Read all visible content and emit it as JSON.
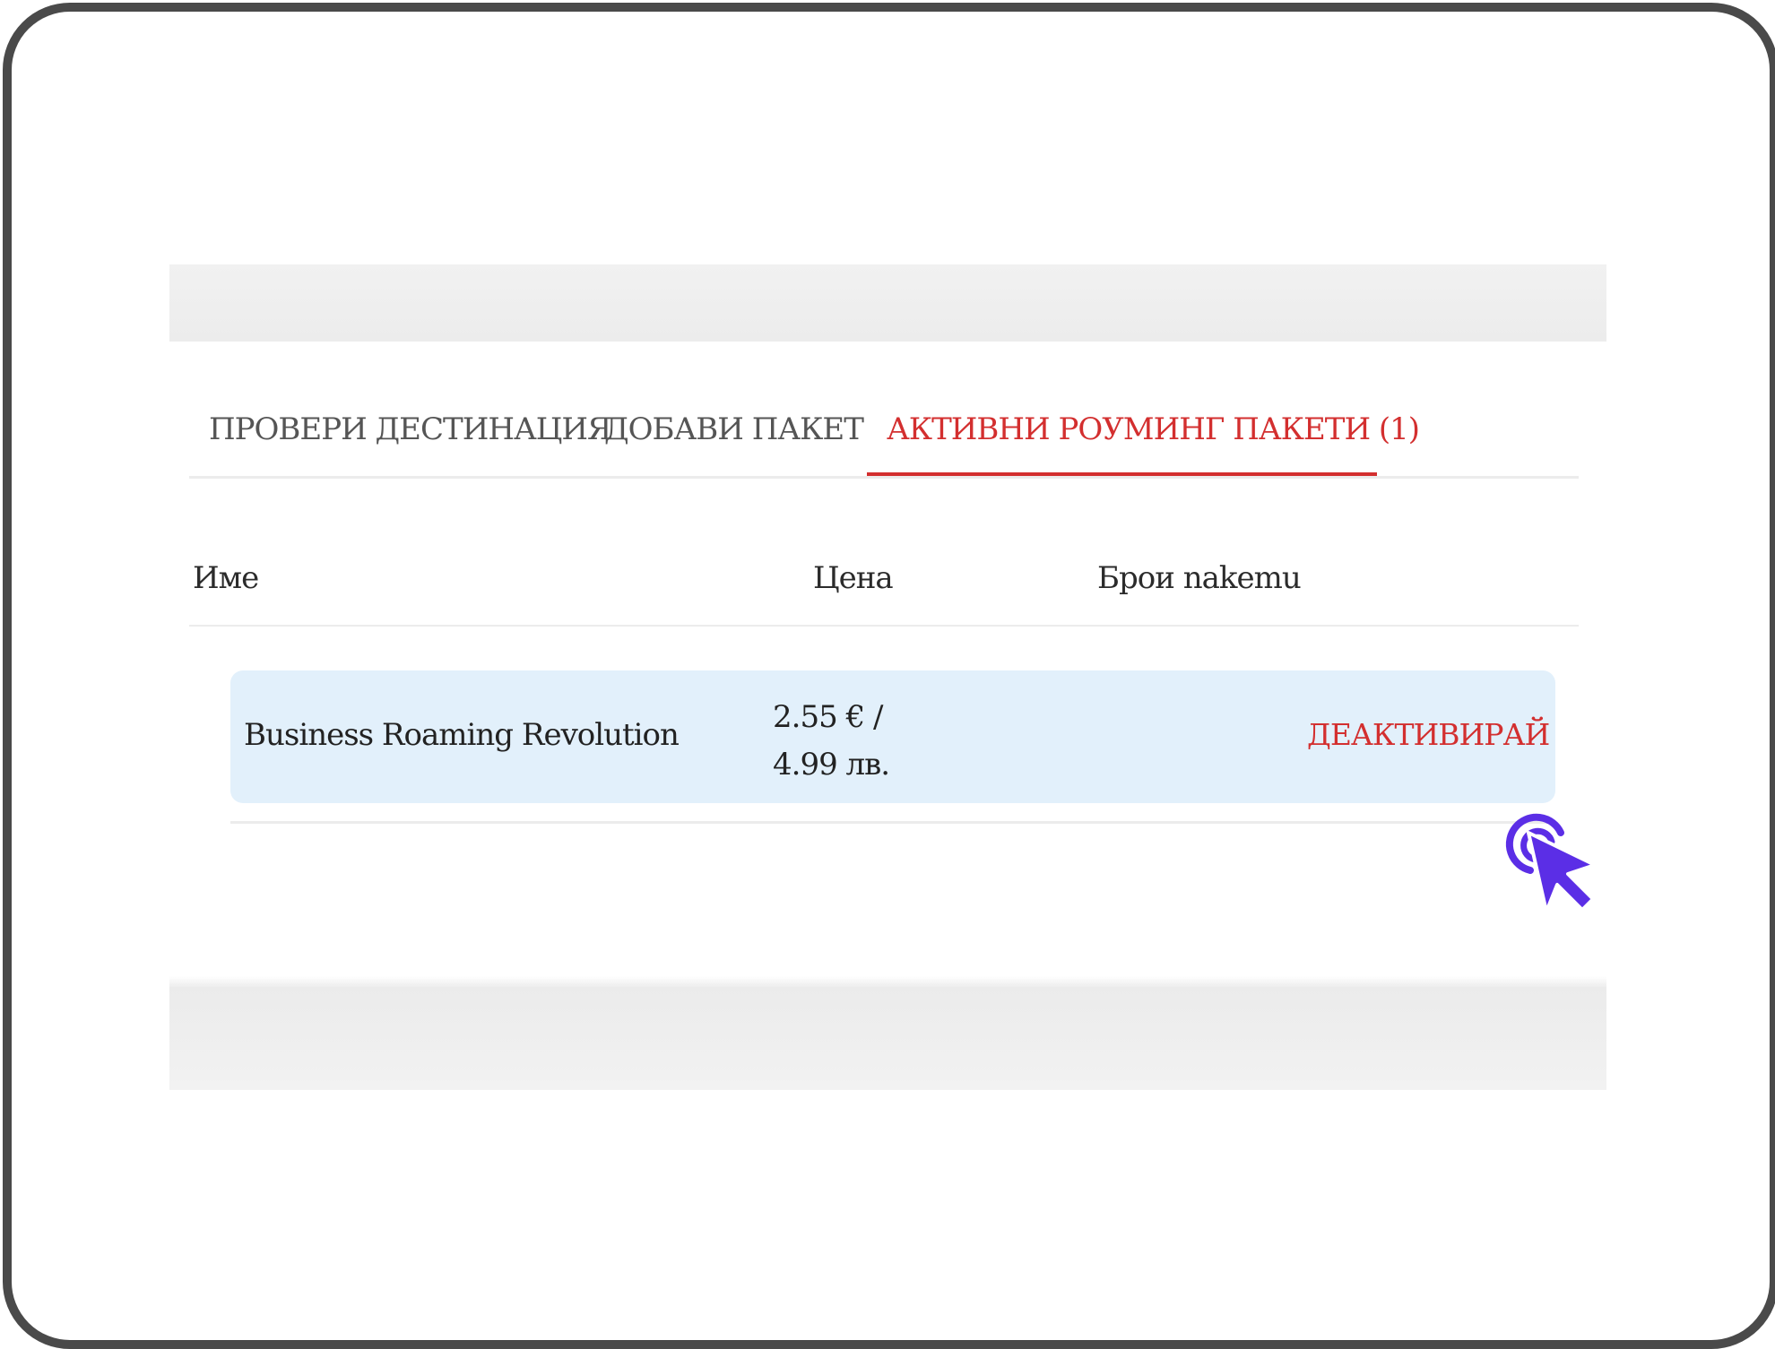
{
  "tabs": [
    {
      "label": "ПРОВЕРИ ДЕСТИНАЦИЯ",
      "active": false
    },
    {
      "label": "ДОБАВИ ПАКЕТ",
      "active": false
    },
    {
      "label": "АКТИВНИ РОУМИНГ ПАКЕТИ (1)",
      "active": true
    }
  ],
  "table": {
    "headers": [
      "Име",
      "Цена",
      "Брои nakemu"
    ],
    "rows": [
      {
        "name": "Business Roaming Revolution",
        "price_line1": "2.55 € /",
        "price_line2": "4.99 лв.",
        "action_label": "ДЕАКТИВИРАЙ"
      }
    ]
  },
  "colors": {
    "accent": "#d32f2f",
    "row_highlight": "#e2f0fb",
    "cursor": "#5b2ee6"
  },
  "icons": {
    "pointer": "hand-pointer-click-icon"
  }
}
